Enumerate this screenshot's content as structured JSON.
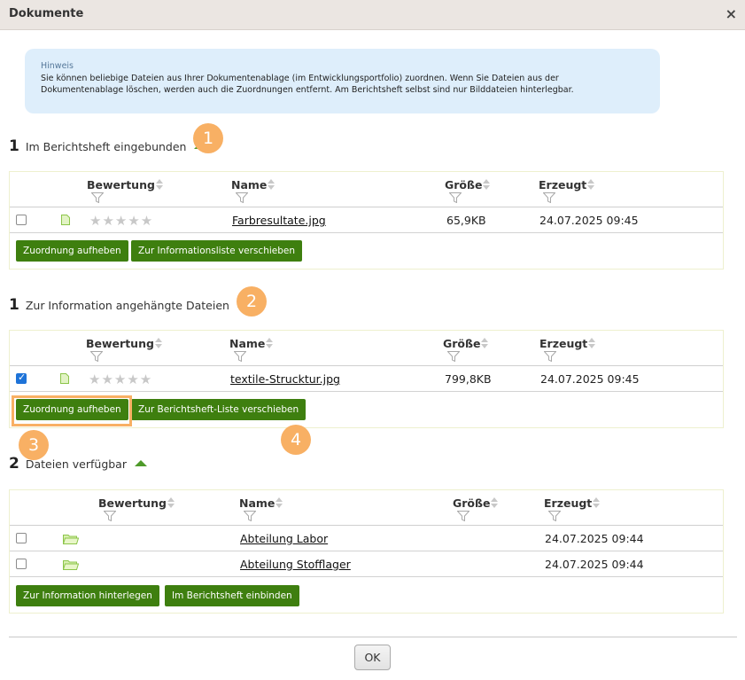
{
  "dialog": {
    "title": "Dokumente",
    "close": "×"
  },
  "hint": {
    "title": "Hinweis",
    "text": "Sie können beliebige Dateien aus Ihrer Dokumentenablage (im Entwicklungsportfolio) zuordnen. Wenn Sie Dateien aus der Dokumentenablage löschen, werden auch die Zuordnungen entfernt. Am Berichtsheft selbst sind nur Bilddateien hinterlegbar."
  },
  "columns": {
    "rating": "Bewertung",
    "name": "Name",
    "size": "Größe",
    "created": "Erzeugt"
  },
  "section1": {
    "count": "1",
    "title": "Im Berichtsheft eingebunden",
    "rows": [
      {
        "checked": false,
        "type": "file",
        "stars": "★★★★★",
        "name": "Farbresultate.jpg",
        "size": "65,9KB",
        "created": "24.07.2025 09:45"
      }
    ],
    "buttons": [
      "Zuordnung aufheben",
      "Zur Informationsliste verschieben"
    ]
  },
  "section2": {
    "count": "1",
    "title": "Zur Information angehängte Dateien",
    "rows": [
      {
        "checked": true,
        "type": "file",
        "stars": "★★★★★",
        "name": "textile-Strucktur.jpg",
        "size": "799,8KB",
        "created": "24.07.2025 09:45"
      }
    ],
    "buttons": [
      "Zuordnung aufheben",
      "Zur Berichtsheft-Liste verschieben"
    ]
  },
  "section3": {
    "count": "2",
    "title": "Dateien verfügbar",
    "rows": [
      {
        "checked": false,
        "type": "folder",
        "name": "Abteilung Labor",
        "created": "24.07.2025 09:44"
      },
      {
        "checked": false,
        "type": "folder",
        "name": "Abteilung Stofflager",
        "created": "24.07.2025 09:44"
      }
    ],
    "buttons": [
      "Zur Information hinterlegen",
      "Im Berichtsheft einbinden"
    ]
  },
  "badges": [
    "1",
    "2",
    "3",
    "4"
  ],
  "footer": {
    "ok": "OK"
  },
  "colors": {
    "button": "#3e7f0f",
    "badge": "#f8b064",
    "hint_bg": "#deeefb",
    "sort_arrow": "#4e9a2a"
  },
  "icons": {
    "file": "file-icon",
    "folder": "folder-icon",
    "filter": "filter-icon",
    "sort": "sort-icon",
    "collapse": "collapse-arrow-icon"
  }
}
